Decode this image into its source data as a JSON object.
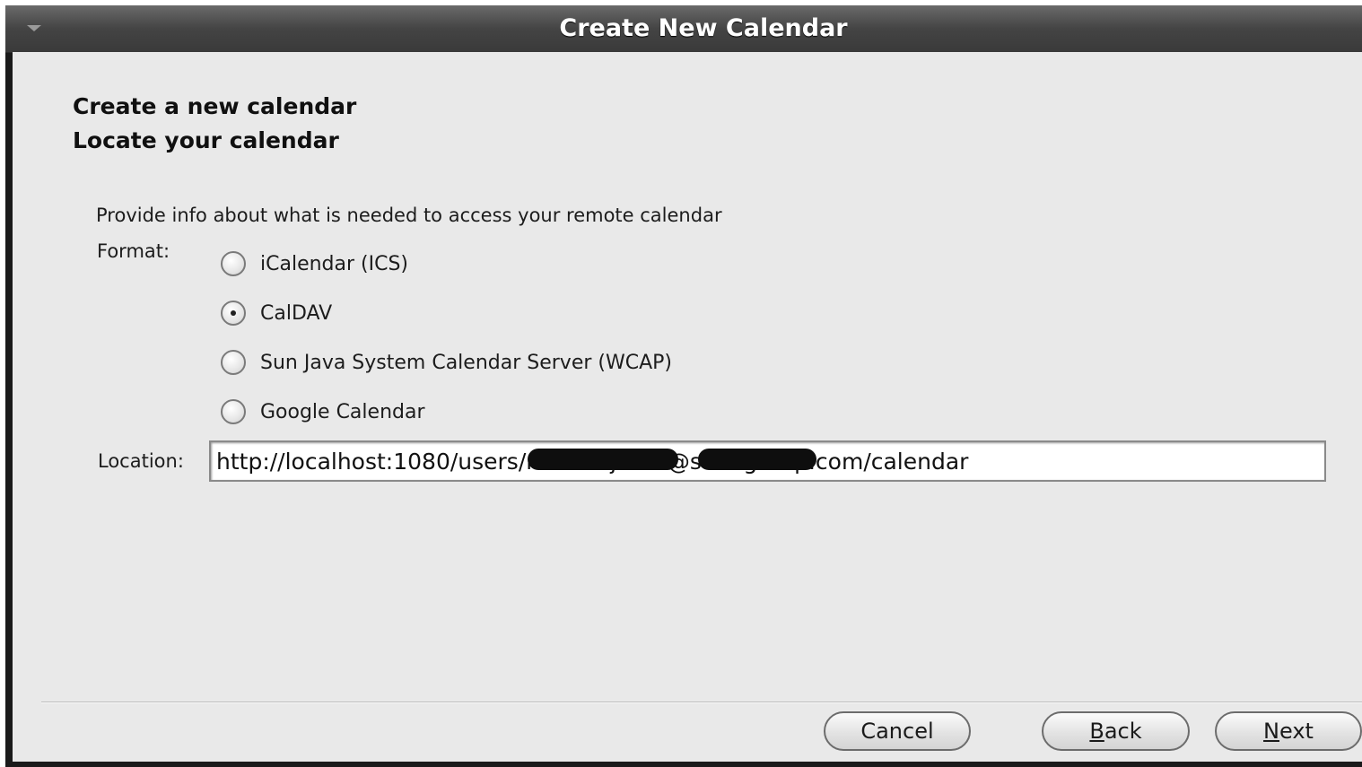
{
  "window": {
    "title": "Create New Calendar"
  },
  "wizard": {
    "heading": "Create a new calendar",
    "subheading": "Locate your calendar",
    "description": "Provide info about what is needed to access your remote calendar",
    "format_label": "Format:",
    "format_options": [
      {
        "label": "iCalendar (ICS)",
        "checked": false
      },
      {
        "label": "CalDAV",
        "checked": true
      },
      {
        "label": "Sun Java System Calendar Server (WCAP)",
        "checked": false
      },
      {
        "label": "Google Calendar",
        "checked": false
      }
    ],
    "location_label": "Location:",
    "location_value": "http://localhost:1080/users/marcin.jessa@saabgroup.com/calendar"
  },
  "buttons": {
    "cancel": "Cancel",
    "back_mnemonic": "B",
    "back_rest": "ack",
    "next_mnemonic": "N",
    "next_rest": "ext"
  }
}
